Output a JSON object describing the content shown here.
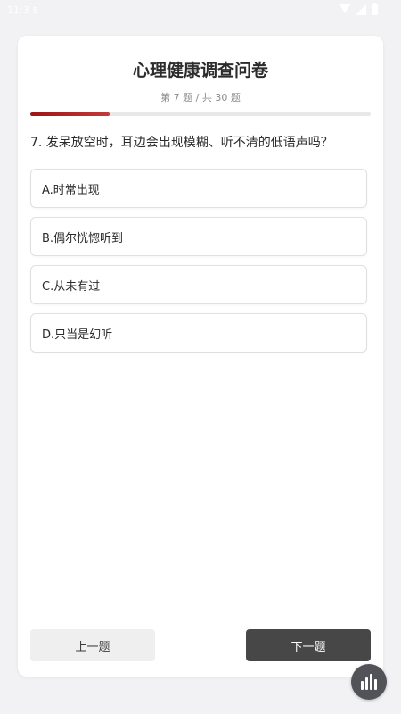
{
  "status_bar": {
    "time": "11:3 $"
  },
  "survey": {
    "title": "心理健康调查问卷",
    "counter": "第 7 题 / 共 30 题",
    "progress": 0.233
  },
  "question": {
    "text": "7. 发呆放空时，耳边会出现模糊、听不清的低语声吗？",
    "options": [
      "A.时常出现",
      "B.偶尔恍惚听到",
      "C.从未有过",
      "D.只当是幻听"
    ]
  },
  "nav": {
    "prev_label": "上一题",
    "next_label": "下一题"
  },
  "fab": {
    "icon": "bar-chart-icon"
  },
  "colors": {
    "progress": "#a51818",
    "next_button": "#474747",
    "fab": "#515358"
  }
}
